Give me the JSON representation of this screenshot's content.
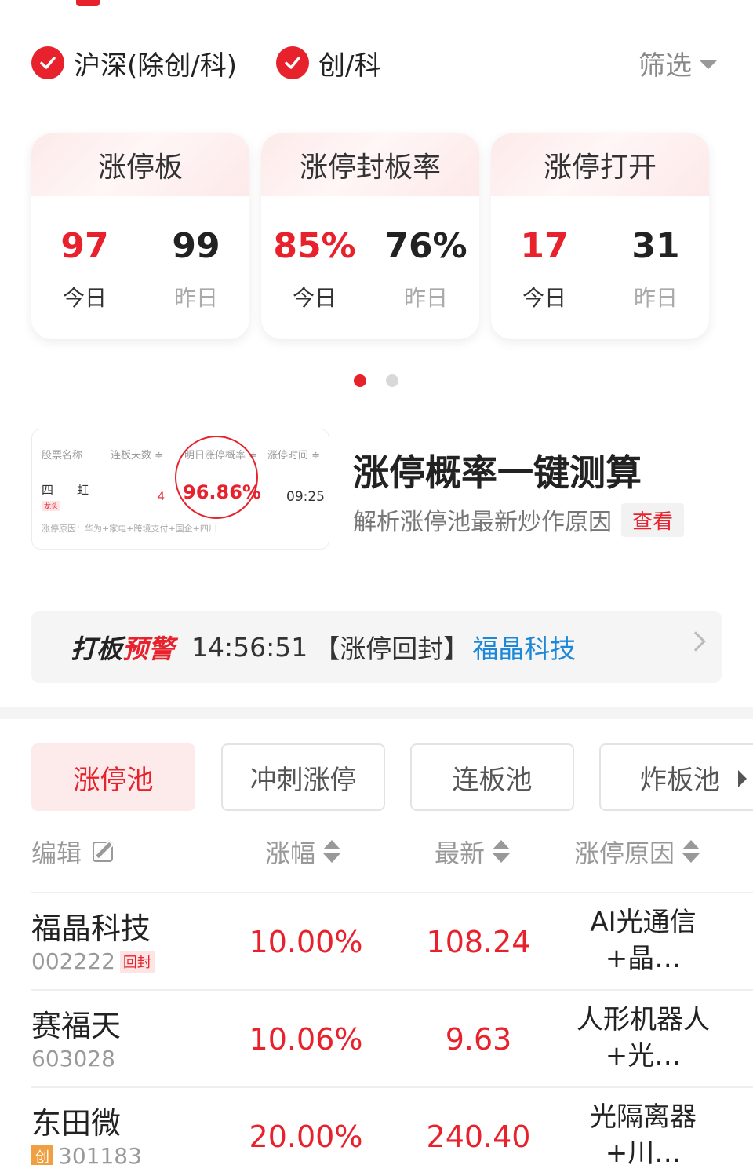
{
  "market_filter": {
    "option1": "沪深(除创/科)",
    "option2": "创/科",
    "filter_label": "筛选"
  },
  "stat_cards": [
    {
      "title": "涨停板",
      "today": "97",
      "yesterday": "99",
      "today_label": "今日",
      "yesterday_label": "昨日"
    },
    {
      "title": "涨停封板率",
      "today": "85%",
      "yesterday": "76%",
      "today_label": "今日",
      "yesterday_label": "昨日"
    },
    {
      "title": "涨停打开",
      "today": "17",
      "yesterday": "31",
      "today_label": "今日",
      "yesterday_label": "昨日"
    }
  ],
  "promo": {
    "image": {
      "col1": "股票名称",
      "col2": "连板天数 ≑",
      "col3": "明日涨停概率 ≑",
      "col4": "涨停时间 ≑",
      "stock": "四　　虹",
      "tag": "龙头",
      "days": "4",
      "prob": "96.86%",
      "time": "09:25",
      "reason": "涨停原因：华为+家电+跨境支付+国企+四川"
    },
    "title": "涨停概率一键测算",
    "subtitle": "解析涨停池最新炒作原因",
    "button": "查看"
  },
  "alert": {
    "prefix1": "打板",
    "prefix2": "预警",
    "time": "14:56:51",
    "tag": "【涨停回封】",
    "stock": "福晶科技"
  },
  "pool_tabs": [
    "涨停池",
    "冲刺涨停",
    "连板池",
    "炸板池"
  ],
  "columns": {
    "edit": "编辑",
    "change": "涨幅",
    "latest": "最新",
    "reason": "涨停原因"
  },
  "rows": [
    {
      "name": "福晶科技",
      "code": "002222",
      "pre_badge": "",
      "badge": "回封",
      "change": "10.00%",
      "price": "108.24",
      "reason1": "AI光通信",
      "reason2": "+晶…"
    },
    {
      "name": "赛福天",
      "code": "603028",
      "pre_badge": "",
      "badge": "",
      "change": "10.06%",
      "price": "9.63",
      "reason1": "人形机器人",
      "reason2": "+光…"
    },
    {
      "name": "东田微",
      "code": "301183",
      "pre_badge": "创",
      "badge": "",
      "change": "20.00%",
      "price": "240.40",
      "reason1": "光隔离器",
      "reason2": "+川…"
    }
  ],
  "colors": {
    "accent": "#e8222d",
    "link": "#1e88d8"
  }
}
